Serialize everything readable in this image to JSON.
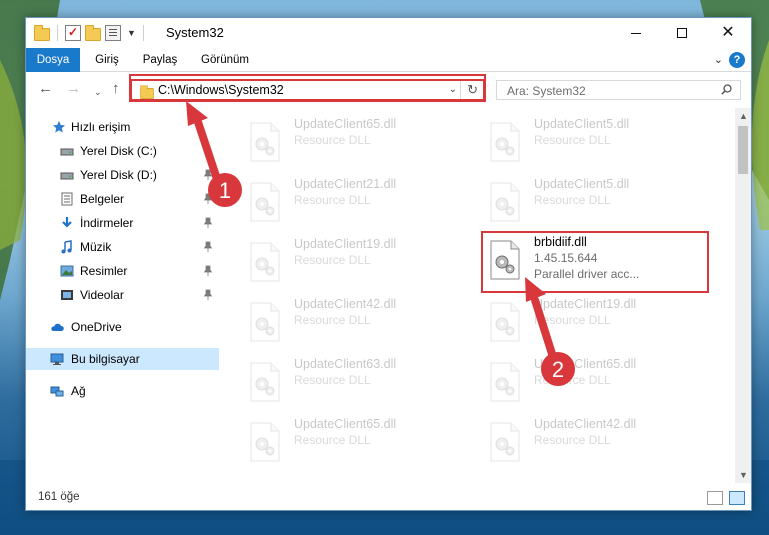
{
  "window": {
    "title": "System32",
    "tabs": [
      "Dosya",
      "Giriş",
      "Paylaş",
      "Görünüm"
    ],
    "help_label": "?"
  },
  "address": {
    "path": "C:\\Windows\\System32"
  },
  "search": {
    "placeholder": "Ara: System32"
  },
  "sidebar": {
    "items": [
      {
        "label": "Hızlı erişim",
        "icon": "star-icon"
      },
      {
        "label": "Yerel Disk (C:)",
        "icon": "drive-icon"
      },
      {
        "label": "Yerel Disk (D:)",
        "icon": "drive-icon"
      },
      {
        "label": "Belgeler",
        "icon": "documents-icon"
      },
      {
        "label": "İndirmeler",
        "icon": "download-icon"
      },
      {
        "label": "Müzik",
        "icon": "music-icon"
      },
      {
        "label": "Resimler",
        "icon": "pictures-icon"
      },
      {
        "label": "Videolar",
        "icon": "videos-icon"
      },
      {
        "label": "OneDrive",
        "icon": "cloud-icon"
      },
      {
        "label": "Bu bilgisayar",
        "icon": "computer-icon"
      },
      {
        "label": "Ağ",
        "icon": "network-icon"
      }
    ]
  },
  "files": {
    "left": [
      {
        "name": "UpdateClient65.dll",
        "desc": "Resource DLL"
      },
      {
        "name": "UpdateClient21.dll",
        "desc": "Resource DLL"
      },
      {
        "name": "UpdateClient19.dll",
        "desc": "Resource DLL"
      },
      {
        "name": "UpdateClient42.dll",
        "desc": "Resource DLL"
      },
      {
        "name": "UpdateClient63.dll",
        "desc": "Resource DLL"
      },
      {
        "name": "UpdateClient65.dll",
        "desc": "Resource DLL"
      }
    ],
    "right": [
      {
        "name": "UpdateClient5.dll",
        "desc": "Resource DLL"
      },
      {
        "name": "UpdateClient5.dll",
        "desc": "Resource DLL"
      },
      {
        "name": "UpdateClient19.dll",
        "desc": "Resource DLL"
      },
      {
        "name": "UpdateClient65.dll",
        "desc": "Resource DLL"
      },
      {
        "name": "UpdateClient42.dll",
        "desc": "Resource DLL"
      }
    ],
    "target": {
      "name": "brbidiif.dll",
      "version": "1.45.15.644",
      "desc": "Parallel driver acc..."
    }
  },
  "status": {
    "count": "161 öğe"
  },
  "annotations": {
    "step1": "1",
    "step2": "2",
    "color": "#d8373b"
  }
}
